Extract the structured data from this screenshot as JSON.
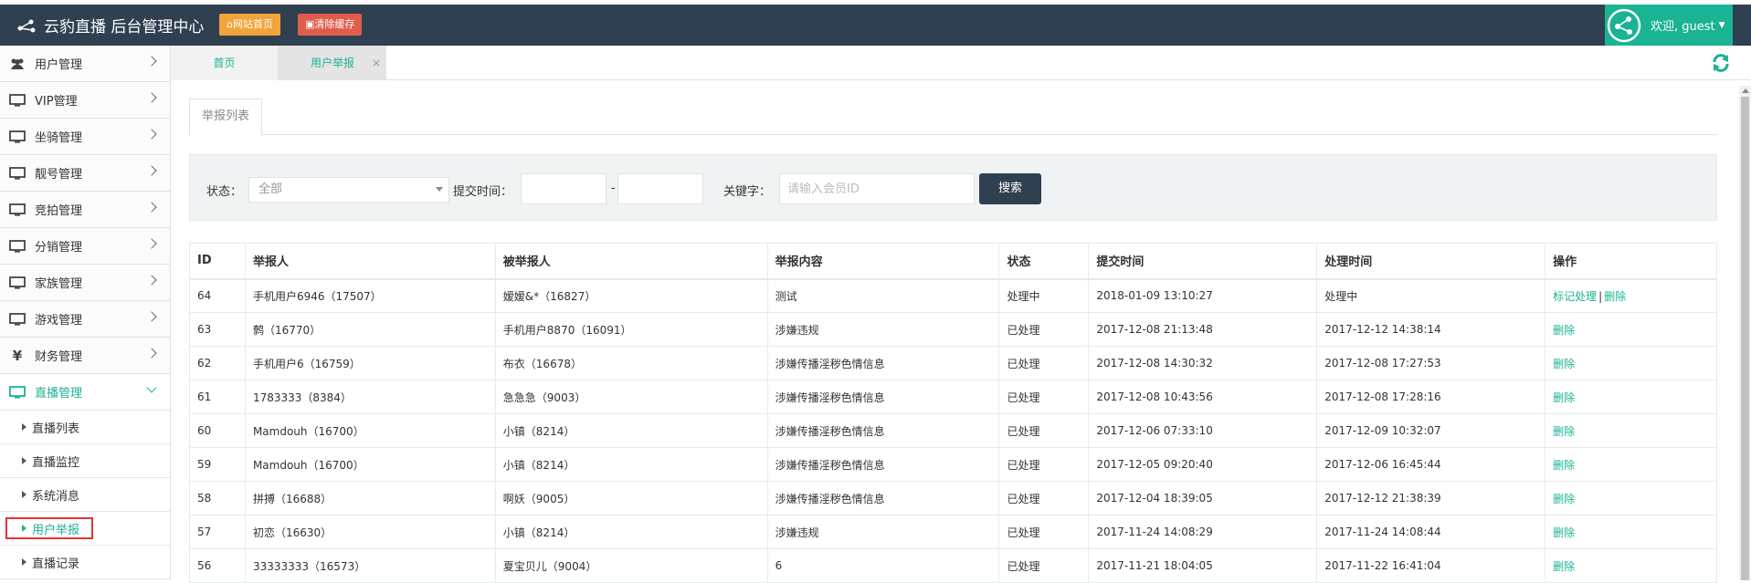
{
  "header": {
    "title": "云豹直播 后台管理中心",
    "home_btn": "网站首页",
    "cache_btn": "清除缓存",
    "welcome": "欢迎, guest"
  },
  "sidebar": {
    "items": [
      {
        "label": "用户管理",
        "icon": "users-icon"
      },
      {
        "label": "VIP管理",
        "icon": "monitor-icon"
      },
      {
        "label": "坐骑管理",
        "icon": "monitor-icon"
      },
      {
        "label": "靓号管理",
        "icon": "monitor-icon"
      },
      {
        "label": "竞拍管理",
        "icon": "monitor-icon"
      },
      {
        "label": "分销管理",
        "icon": "monitor-icon"
      },
      {
        "label": "家族管理",
        "icon": "monitor-icon"
      },
      {
        "label": "游戏管理",
        "icon": "monitor-icon"
      },
      {
        "label": "财务管理",
        "icon": "yen-icon"
      },
      {
        "label": "直播管理",
        "icon": "monitor-icon"
      }
    ],
    "sub_items": [
      "直播列表",
      "直播监控",
      "系统消息",
      "用户举报",
      "直播记录"
    ]
  },
  "tabs": {
    "home": "首页",
    "report": "用户举报",
    "close": "×"
  },
  "subtab": "举报列表",
  "filter": {
    "status_label": "状态：",
    "status_value": "全部",
    "time_label": "提交时间：",
    "dash": "-",
    "keyword_label": "关键字：",
    "keyword_placeholder": "请输入会员ID",
    "search_btn": "搜索"
  },
  "table": {
    "headers": [
      "ID",
      "举报人",
      "被举报人",
      "举报内容",
      "状态",
      "提交时间",
      "处理时间",
      "操作"
    ],
    "rows": [
      {
        "id": "64",
        "reporter": "手机用户6946（17507）",
        "reported": "嫒嫒&*（16827）",
        "content": "测试",
        "status": "处理中",
        "submit": "2018-01-09 13:10:27",
        "handle": "处理中",
        "ops": [
          "标记处理",
          "删除"
        ]
      },
      {
        "id": "63",
        "reporter": "鹩（16770）",
        "reported": "手机用户8870（16091）",
        "content": "涉嫌违规",
        "status": "已处理",
        "submit": "2017-12-08 21:13:48",
        "handle": "2017-12-12 14:38:14",
        "ops": [
          "删除"
        ]
      },
      {
        "id": "62",
        "reporter": "手机用户6（16759）",
        "reported": "布衣（16678）",
        "content": "涉嫌传播淫秽色情信息",
        "status": "已处理",
        "submit": "2017-12-08 14:30:32",
        "handle": "2017-12-08 17:27:53",
        "ops": [
          "删除"
        ]
      },
      {
        "id": "61",
        "reporter": "1783333（8384）",
        "reported": "急急急（9003）",
        "content": "涉嫌传播淫秽色情信息",
        "status": "已处理",
        "submit": "2017-12-08 10:43:56",
        "handle": "2017-12-08 17:28:16",
        "ops": [
          "删除"
        ]
      },
      {
        "id": "60",
        "reporter": "Mamdouh（16700）",
        "reported": "小镇（8214）",
        "content": "涉嫌传播淫秽色情信息",
        "status": "已处理",
        "submit": "2017-12-06 07:33:10",
        "handle": "2017-12-09 10:32:07",
        "ops": [
          "删除"
        ]
      },
      {
        "id": "59",
        "reporter": "Mamdouh（16700）",
        "reported": "小镇（8214）",
        "content": "涉嫌传播淫秽色情信息",
        "status": "已处理",
        "submit": "2017-12-05 09:20:40",
        "handle": "2017-12-06 16:45:44",
        "ops": [
          "删除"
        ]
      },
      {
        "id": "58",
        "reporter": "拼搏（16688）",
        "reported": "啊妖（9005）",
        "content": "涉嫌传播淫秽色情信息",
        "status": "已处理",
        "submit": "2017-12-04 18:39:05",
        "handle": "2017-12-12 21:38:39",
        "ops": [
          "删除"
        ]
      },
      {
        "id": "57",
        "reporter": "初恋（16630）",
        "reported": "小镇（8214）",
        "content": "涉嫌违规",
        "status": "已处理",
        "submit": "2017-11-24 14:08:29",
        "handle": "2017-11-24 14:08:44",
        "ops": [
          "删除"
        ]
      },
      {
        "id": "56",
        "reporter": "33333333（16573）",
        "reported": "夏宝贝儿（9004）",
        "content": "6",
        "status": "已处理",
        "submit": "2017-11-21 18:04:05",
        "handle": "2017-11-22 16:41:04",
        "ops": [
          "删除"
        ]
      }
    ]
  },
  "colors": {
    "header_bg": "#2f4050",
    "accent": "#1ab394",
    "home_btn": "#f0a43a",
    "cache_btn": "#e05c4b",
    "highlight": "#e53333"
  }
}
